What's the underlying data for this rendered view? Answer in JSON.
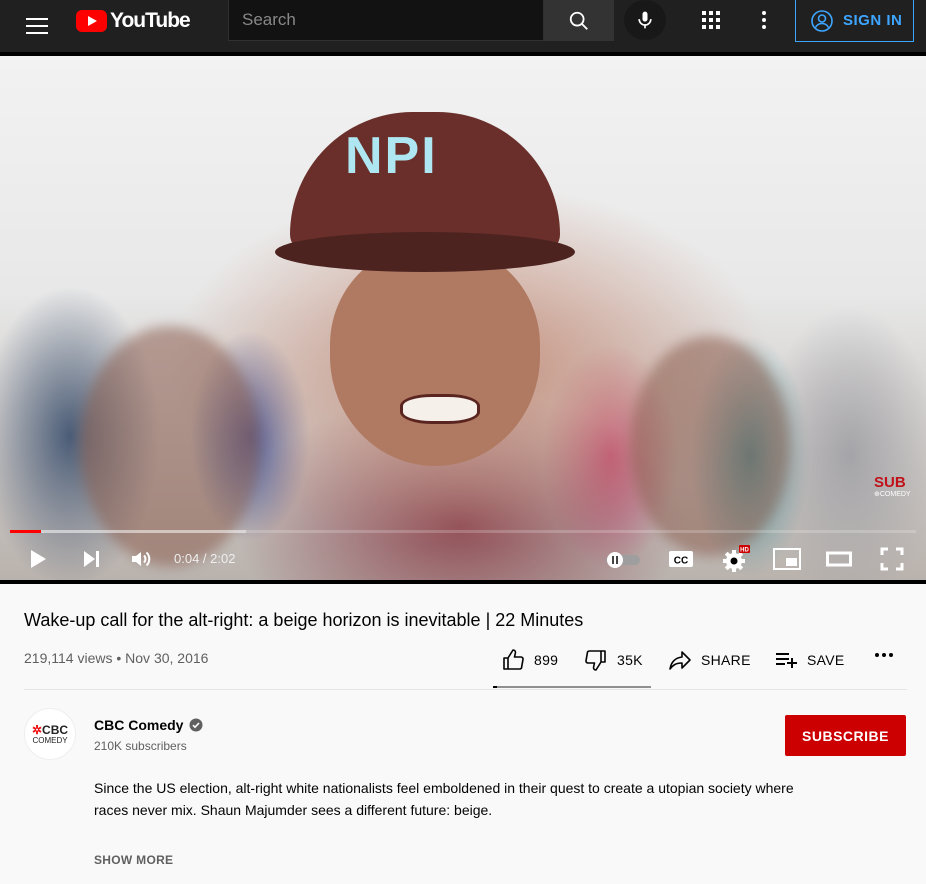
{
  "header": {
    "logo_text": "YouTube",
    "search": {
      "placeholder": "Search",
      "value": ""
    },
    "sign_in_label": "SIGN IN"
  },
  "player": {
    "time_current": "0:04",
    "time_separator": " / ",
    "time_total": "2:02",
    "time_display": "0:04 / 2:02",
    "progress_played_fraction": 0.034,
    "progress_buffered_fraction": 0.26,
    "cap_text": "NPI",
    "watermark": {
      "line1": "SUB",
      "line2": "⊕COMEDY"
    },
    "settings_badge": "HD"
  },
  "video": {
    "title": "Wake-up call for the alt-right: a beige horizon is inevitable | 22 Minutes",
    "views": "219,114 views",
    "meta_separator": "•",
    "date": "Nov 30, 2016",
    "likes": "899",
    "dislikes": "35K",
    "share_label": "SHARE",
    "save_label": "SAVE",
    "like_ratio": 0.025
  },
  "channel": {
    "avatar_line1": "CBC",
    "avatar_line2": "COMEDY",
    "name": "CBC Comedy",
    "subscribers": "210K subscribers",
    "subscribe_label": "SUBSCRIBE"
  },
  "description": {
    "text": "Since the US election, alt-right white nationalists feel emboldened in their quest to create a utopian society where races never mix. Shaun Majumder sees a different future: beige.",
    "show_more_label": "SHOW MORE"
  },
  "colors": {
    "brand_red": "#ff0000",
    "subscribe_red": "#cc0000",
    "signin_blue": "#3ea6ff",
    "topbar_bg": "#202020"
  }
}
